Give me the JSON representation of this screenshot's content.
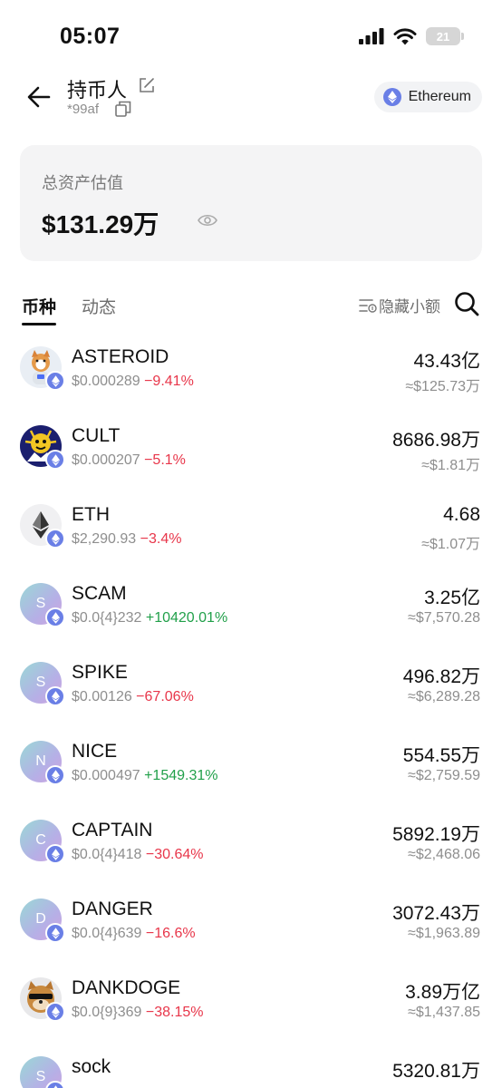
{
  "status_bar": {
    "time": "05:07",
    "battery": "21"
  },
  "header": {
    "wallet_name": "持币人",
    "wallet_address": "*99af",
    "chain": "Ethereum"
  },
  "assets": {
    "label": "总资产估值",
    "value": "$131.29万"
  },
  "tabs": {
    "active": "币种",
    "inactive": "动态",
    "hide_small": "隐藏小额"
  },
  "colors": {
    "negative": "#e8364a",
    "positive": "#21a04a",
    "eth_badge": "#6a7fe6"
  },
  "tokens": [
    {
      "symbol": "ASTEROID",
      "price": "$0.000289",
      "change": "−9.41%",
      "amount": "43.43亿",
      "fiat": "≈$125.73万",
      "avatar": "shiba-astronaut-image",
      "letter": "",
      "trend": "down"
    },
    {
      "symbol": "CULT",
      "price": "$0.000207",
      "change": "−5.1%",
      "amount": "8686.98万",
      "fiat": "≈$1.81万",
      "avatar": "cult-logo-image",
      "letter": "",
      "trend": "down"
    },
    {
      "symbol": "ETH",
      "price": "$2,290.93",
      "change": "−3.4%",
      "amount": "4.68",
      "fiat": "≈$1.07万",
      "avatar": "ethereum-logo",
      "letter": "",
      "trend": "down"
    },
    {
      "symbol": "SCAM",
      "price": "$0.0{4}232",
      "change": "+10420.01%",
      "amount": "3.25亿",
      "fiat": "≈$7,570.28",
      "avatar": "letter",
      "letter": "S",
      "trend": "up"
    },
    {
      "symbol": "SPIKE",
      "price": "$0.00126",
      "change": "−67.06%",
      "amount": "496.82万",
      "fiat": "≈$6,289.28",
      "avatar": "letter",
      "letter": "S",
      "trend": "down"
    },
    {
      "symbol": "NICE",
      "price": "$0.000497",
      "change": "+1549.31%",
      "amount": "554.55万",
      "fiat": "≈$2,759.59",
      "avatar": "letter",
      "letter": "N",
      "trend": "up"
    },
    {
      "symbol": "CAPTAIN",
      "price": "$0.0{4}418",
      "change": "−30.64%",
      "amount": "5892.19万",
      "fiat": "≈$2,468.06",
      "avatar": "letter",
      "letter": "C",
      "trend": "down"
    },
    {
      "symbol": "DANGER",
      "price": "$0.0{4}639",
      "change": "−16.6%",
      "amount": "3072.43万",
      "fiat": "≈$1,963.89",
      "avatar": "letter",
      "letter": "D",
      "trend": "down"
    },
    {
      "symbol": "DANKDOGE",
      "price": "$0.0{9}369",
      "change": "−38.15%",
      "amount": "3.89万亿",
      "fiat": "≈$1,437.85",
      "avatar": "doge-sunglasses-image",
      "letter": "",
      "trend": "down"
    },
    {
      "symbol": "sock",
      "price": "",
      "change": "",
      "amount": "5320.81万",
      "fiat": "",
      "avatar": "letter",
      "letter": "S",
      "trend": "down"
    }
  ]
}
